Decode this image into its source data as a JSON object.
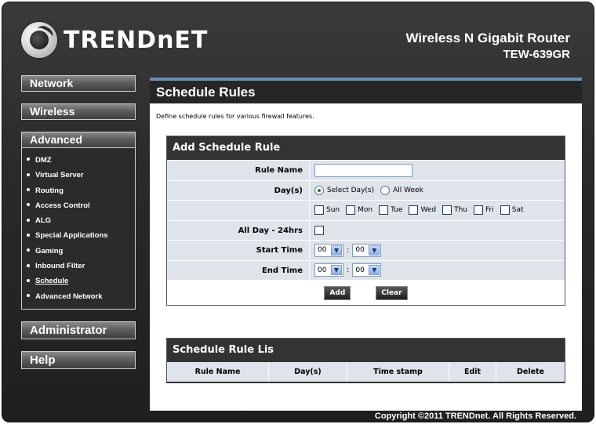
{
  "brand": {
    "logo_text": "TRENDnET"
  },
  "product": {
    "name": "Wireless N Gigabit Router",
    "model": "TEW-639GR"
  },
  "sidebar": {
    "network": "Network",
    "wireless": "Wireless",
    "advanced": "Advanced",
    "advanced_items": [
      "DMZ",
      "Virtual Server",
      "Routing",
      "Access Control",
      "ALG",
      "Special Applications",
      "Gaming",
      "Inbound Filter",
      "Schedule",
      "Advanced Network"
    ],
    "administrator": "Administrator",
    "help": "Help"
  },
  "page": {
    "title": "Schedule Rules",
    "description": "Define schedule rules for various firewall features."
  },
  "add_rule": {
    "heading": "Add Schedule Rule",
    "rule_name_label": "Rule Name",
    "rule_name_value": "",
    "days_label": "Day(s)",
    "days_options": [
      "Select Day(s)",
      "All Week"
    ],
    "days_selected": "Select Day(s)",
    "weekdays": [
      "Sun",
      "Mon",
      "Tue",
      "Wed",
      "Thu",
      "Fri",
      "Sat"
    ],
    "all_day_label": "All Day - 24hrs",
    "start_time_label": "Start Time",
    "start_hour": "00",
    "start_minute": "00",
    "end_time_label": "End Time",
    "end_hour": "00",
    "end_minute": "00",
    "time_separator": ":",
    "add_button": "Add",
    "clear_button": "Clear"
  },
  "rule_list": {
    "heading": "Schedule Rule Lis",
    "columns": [
      "Rule Name",
      "Day(s)",
      "Time stamp",
      "Edit",
      "Delete"
    ]
  },
  "footer": {
    "copyright": "Copyright ©2011 TRENDnet. All Rights Reserved."
  }
}
